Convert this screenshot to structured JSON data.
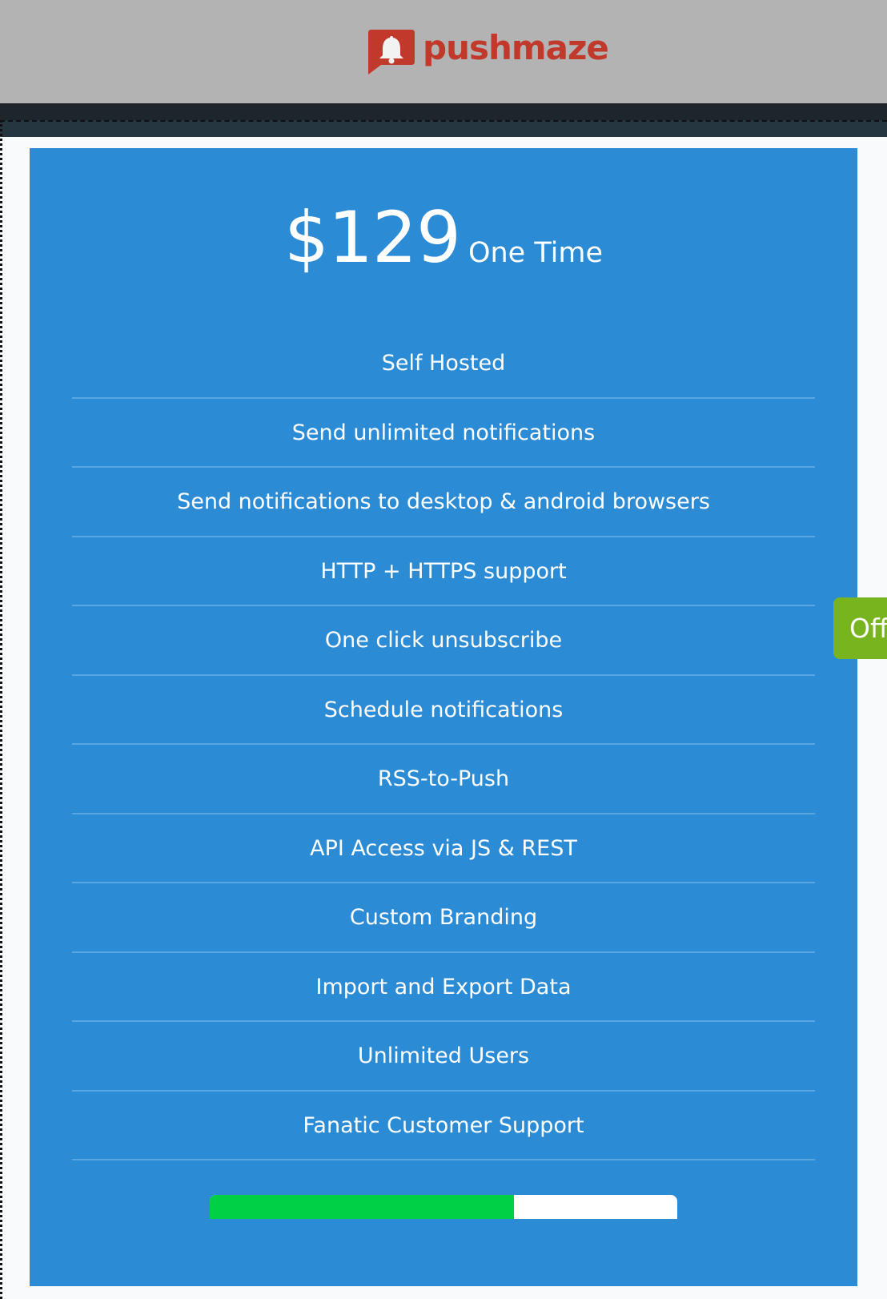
{
  "header": {
    "brand_name": "pushmaze",
    "logo_icon": "bell-chat-bubble-icon",
    "brand_color": "#c0392b"
  },
  "pricing": {
    "amount": "$129",
    "term": "One Time",
    "card_color": "#2b8bd5",
    "features": [
      "Self Hosted",
      "Send unlimited notifications",
      "Send notifications to desktop & android browsers",
      "HTTP + HTTPS support",
      "One click unsubscribe",
      "Schedule notifications",
      "RSS-to-Push",
      "API Access via JS & REST",
      "Custom Branding",
      "Import and Export Data",
      "Unlimited Users",
      "Fanatic Customer Support"
    ],
    "progress_percent": 65,
    "progress_color": "#00d046"
  },
  "offer_tab": {
    "label": "Off",
    "color": "#77b41d"
  }
}
